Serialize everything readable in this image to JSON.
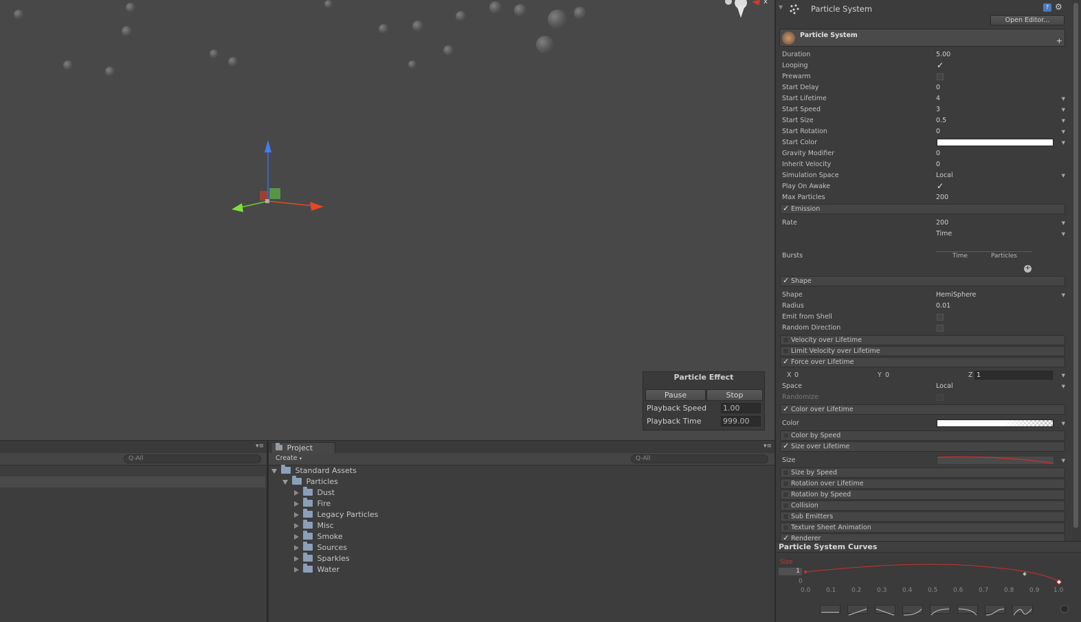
{
  "scene": {
    "gizmo": {
      "axis_label": "x"
    }
  },
  "particle_effect": {
    "title": "Particle Effect",
    "pause_label": "Pause",
    "stop_label": "Stop",
    "playback_speed_label": "Playback Speed",
    "playback_speed_value": "1.00",
    "playback_time_label": "Playback Time",
    "playback_time_value": "999.00"
  },
  "hierarchy": {
    "search_placeholder": "Q-All"
  },
  "project": {
    "tab_label": "Project",
    "create_label": "Create",
    "search_placeholder": "Q-All",
    "tree": {
      "root": "Standard Assets",
      "child": "Particles",
      "folders": [
        "Dust",
        "Fire",
        "Legacy Particles",
        "Misc",
        "Smoke",
        "Sources",
        "Sparkles",
        "Water"
      ]
    }
  },
  "inspector": {
    "component_title": "Particle System",
    "open_editor_label": "Open Editor...",
    "system_name": "Particle System",
    "main_props": [
      {
        "label": "Duration",
        "value": "5.00"
      },
      {
        "label": "Looping",
        "check": true
      },
      {
        "label": "Prewarm",
        "check": false
      },
      {
        "label": "Start Delay",
        "value": "0"
      },
      {
        "label": "Start Lifetime",
        "value": "4",
        "dropdown": true
      },
      {
        "label": "Start Speed",
        "value": "3",
        "dropdown": true
      },
      {
        "label": "Start Size",
        "value": "0.5",
        "dropdown": true
      },
      {
        "label": "Start Rotation",
        "value": "0",
        "dropdown": true
      },
      {
        "label": "Start Color",
        "color": "#ffffff",
        "dropdown": true
      },
      {
        "label": "Gravity Modifier",
        "value": "0"
      },
      {
        "label": "Inherit Velocity",
        "value": "0"
      },
      {
        "label": "Simulation Space",
        "value": "Local",
        "dropdown": true
      },
      {
        "label": "Play On Awake",
        "check": true
      },
      {
        "label": "Max Particles",
        "value": "200"
      }
    ],
    "emission": {
      "label": "Emission",
      "rate_label": "Rate",
      "rate_value": "200",
      "rate_mode": "Time",
      "bursts_label": "Bursts",
      "bursts_col_time": "Time",
      "bursts_col_particles": "Particles"
    },
    "shape": {
      "label": "Shape",
      "shape_label": "Shape",
      "shape_value": "HemiSphere",
      "radius_label": "Radius",
      "radius_value": "0.01",
      "emit_from_shell_label": "Emit from Shell",
      "random_direction_label": "Random Direction"
    },
    "velocity_over_lifetime": "Velocity over Lifetime",
    "limit_velocity_over_lifetime": "Limit Velocity over Lifetime",
    "force_over_lifetime": {
      "label": "Force over Lifetime",
      "x_label": "X",
      "x_value": "0",
      "y_label": "Y",
      "y_value": "0",
      "z_label": "Z",
      "z_value": "1",
      "space_label": "Space",
      "space_value": "Local",
      "randomize_label": "Randomize"
    },
    "color_over_lifetime": {
      "label": "Color over Lifetime",
      "color_label": "Color"
    },
    "color_by_speed": "Color by Speed",
    "size_over_lifetime": {
      "label": "Size over Lifetime",
      "size_label": "Size"
    },
    "size_by_speed": "Size by Speed",
    "rotation_over_lifetime": "Rotation over Lifetime",
    "rotation_by_speed": "Rotation by Speed",
    "collision": "Collision",
    "sub_emitters": "Sub Emitters",
    "texture_sheet_animation": "Texture Sheet Animation",
    "renderer": "Renderer"
  },
  "curves": {
    "title": "Particle System Curves",
    "curve_label": "Size",
    "y_max": "1",
    "y_min": "0",
    "x_ticks": [
      "0.0",
      "0.1",
      "0.2",
      "0.3",
      "0.4",
      "0.5",
      "0.6",
      "0.7",
      "0.8",
      "0.9",
      "1.0"
    ],
    "curve_color": "#d03030"
  }
}
